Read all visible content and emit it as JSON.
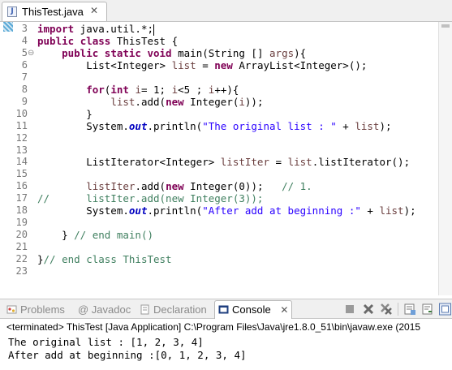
{
  "editor_tab": {
    "title": "ThisTest.java",
    "close": "✕",
    "file_icon": "java-file-icon",
    "file_icon_glyph": "J"
  },
  "code_lines": [
    {
      "n": "3",
      "fold": "",
      "html": "<span class=\"kw\">import</span> java.util.*;<span class=\"caret\"></span>"
    },
    {
      "n": "4",
      "fold": "",
      "html": "<span class=\"kw\">public</span> <span class=\"kw\">class</span> ThisTest {"
    },
    {
      "n": "5",
      "fold": "⊖",
      "html": "    <span class=\"kw\">public</span> <span class=\"kw\">static</span> <span class=\"kw\">void</span> main(String [] <span class=\"var\">args</span>){"
    },
    {
      "n": "6",
      "fold": "",
      "html": "        List&lt;Integer&gt; <span class=\"var\">list</span> = <span class=\"kw\">new</span> ArrayList&lt;Integer&gt;();"
    },
    {
      "n": "7",
      "fold": "",
      "html": ""
    },
    {
      "n": "8",
      "fold": "",
      "html": "        <span class=\"kw\">for</span>(<span class=\"kw\">int</span> <span class=\"var\">i</span>= 1; <span class=\"var\">i</span>&lt;5 ; <span class=\"var\">i</span>++){"
    },
    {
      "n": "9",
      "fold": "",
      "html": "            <span class=\"var\">list</span>.add(<span class=\"kw\">new</span> Integer(<span class=\"var\">i</span>));"
    },
    {
      "n": "10",
      "fold": "",
      "html": "        }"
    },
    {
      "n": "11",
      "fold": "",
      "html": "        System.<span class=\"fld\">out</span>.println(<span class=\"str\">\"The original list : \"</span> + <span class=\"var\">list</span>);"
    },
    {
      "n": "12",
      "fold": "",
      "html": ""
    },
    {
      "n": "13",
      "fold": "",
      "html": ""
    },
    {
      "n": "14",
      "fold": "",
      "html": "        ListIterator&lt;Integer&gt; <span class=\"var\">listIter</span> = <span class=\"var\">list</span>.listIterator();"
    },
    {
      "n": "15",
      "fold": "",
      "html": ""
    },
    {
      "n": "16",
      "fold": "",
      "html": "        <span class=\"var\">listIter</span>.add(<span class=\"kw\">new</span> Integer(0));   <span class=\"cmt\">// 1.</span>"
    },
    {
      "n": "17",
      "fold": "",
      "html": "<span class=\"cmt\">//      listIter.add(new Integer(3));</span>"
    },
    {
      "n": "18",
      "fold": "",
      "html": "        System.<span class=\"fld\">out</span>.println(<span class=\"str\">\"After add at beginning :\"</span> + <span class=\"var\">list</span>);"
    },
    {
      "n": "19",
      "fold": "",
      "html": ""
    },
    {
      "n": "20",
      "fold": "",
      "html": "    } <span class=\"cmt\">// end main()</span>"
    },
    {
      "n": "21",
      "fold": "",
      "html": ""
    },
    {
      "n": "22",
      "fold": "",
      "html": "}<span class=\"cmt\">// end class ThisTest</span>"
    },
    {
      "n": "23",
      "fold": "",
      "html": ""
    }
  ],
  "bottom_tabs": [
    {
      "label": "Problems",
      "icon": "problems-icon"
    },
    {
      "label": "@ Javadoc",
      "icon": ""
    },
    {
      "label": "Declaration",
      "icon": "declaration-icon"
    },
    {
      "label": "Console",
      "icon": "console-icon",
      "active": true,
      "close": "✕"
    }
  ],
  "console": {
    "terminated": "<terminated> ThisTest [Java Application] C:\\Program Files\\Java\\jre1.8.0_51\\bin\\javaw.exe (2015",
    "output": [
      "The original list : [1, 2, 3, 4]",
      "After add at beginning :[0, 1, 2, 3, 4]"
    ]
  }
}
